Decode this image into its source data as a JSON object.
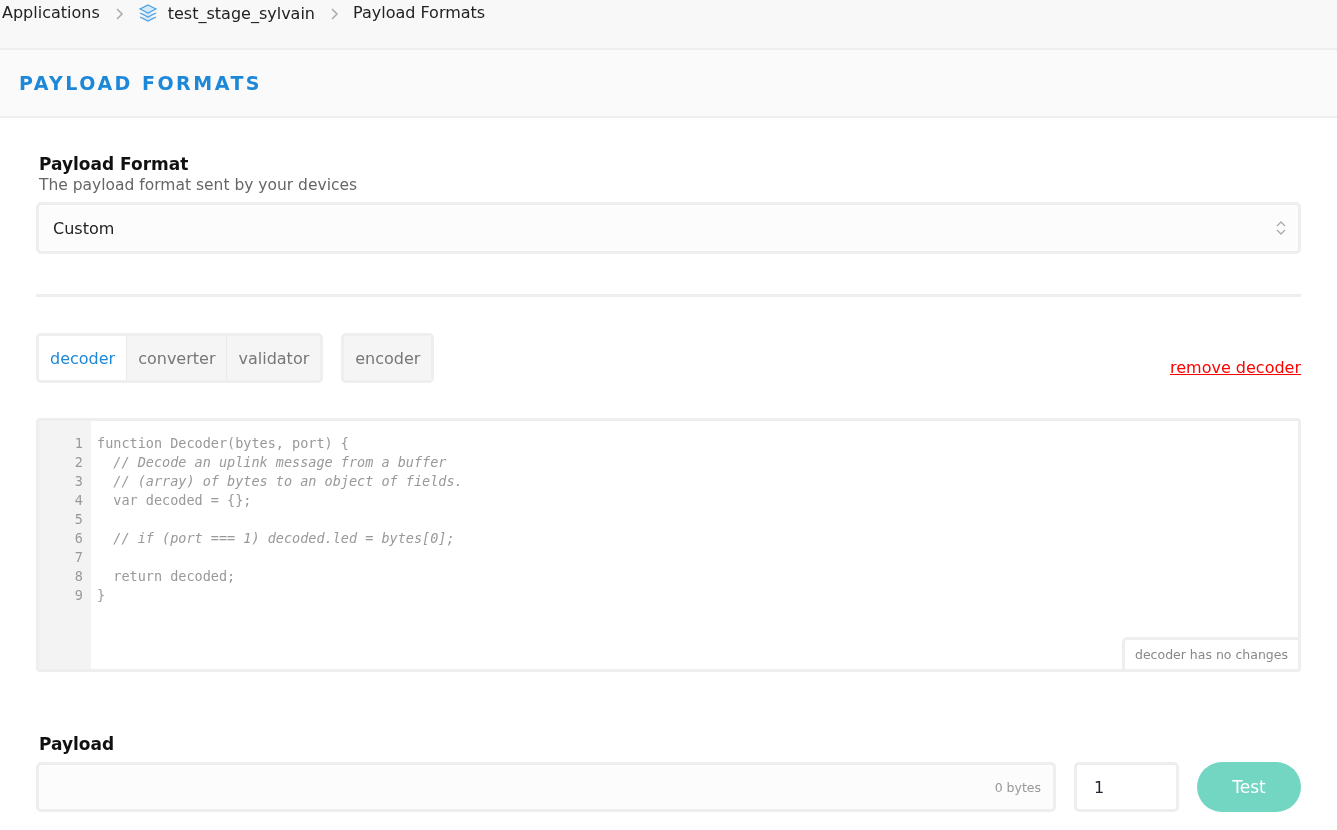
{
  "breadcrumbs": [
    {
      "label": "Applications",
      "kind": "text"
    },
    {
      "label": "test_stage_sylvain",
      "kind": "app"
    },
    {
      "label": "Payload Formats",
      "kind": "text"
    }
  ],
  "page_title": "PAYLOAD FORMATS",
  "format": {
    "label": "Payload Format",
    "description": "The payload format sent by your devices",
    "value": "Custom"
  },
  "tab_groups": [
    [
      {
        "label": "decoder",
        "selected": true
      },
      {
        "label": "converter",
        "selected": false
      },
      {
        "label": "validator",
        "selected": false
      }
    ],
    [
      {
        "label": "encoder",
        "selected": false
      }
    ]
  ],
  "remove_link": "remove decoder",
  "editor": {
    "lines": [
      {
        "number": "1",
        "text": "function Decoder(bytes, port) {",
        "kind": "code"
      },
      {
        "number": "2",
        "text": "  // Decode an uplink message from a buffer",
        "kind": "comment"
      },
      {
        "number": "3",
        "text": "  // (array) of bytes to an object of fields.",
        "kind": "comment"
      },
      {
        "number": "4",
        "text": "  var decoded = {};",
        "kind": "code"
      },
      {
        "number": "5",
        "kind": "blank"
      },
      {
        "number": "6",
        "text": "  // if (port === 1) decoded.led = bytes[0];",
        "kind": "comment"
      },
      {
        "number": "7",
        "kind": "blank"
      },
      {
        "number": "8",
        "text": "  return decoded;",
        "kind": "code"
      },
      {
        "number": "9",
        "text": "}",
        "kind": "code"
      }
    ],
    "status": "decoder has no changes"
  },
  "payload": {
    "label": "Payload",
    "byte_count": "0 bytes",
    "port": "1",
    "button": "Test"
  }
}
